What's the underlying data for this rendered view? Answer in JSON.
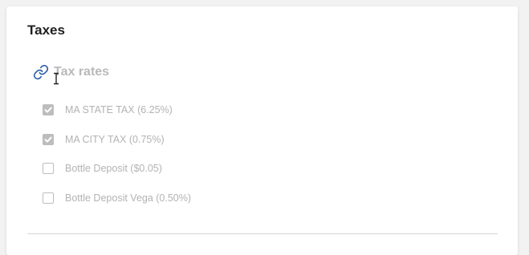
{
  "section": {
    "title": "Taxes"
  },
  "group": {
    "label": "Tax rates",
    "icon": "link-icon",
    "icon_color": "#2f5fa8"
  },
  "taxes": [
    {
      "label": "MA STATE TAX (6.25%)",
      "checked": true
    },
    {
      "label": "MA CITY TAX (0.75%)",
      "checked": true
    },
    {
      "label": "Bottle Deposit ($0.05)",
      "checked": false
    },
    {
      "label": "Bottle Deposit Vega (0.50%)",
      "checked": false
    }
  ],
  "colors": {
    "disabled_text": "#b3b3b3",
    "checkbox_disabled": "#bdbdbd"
  }
}
